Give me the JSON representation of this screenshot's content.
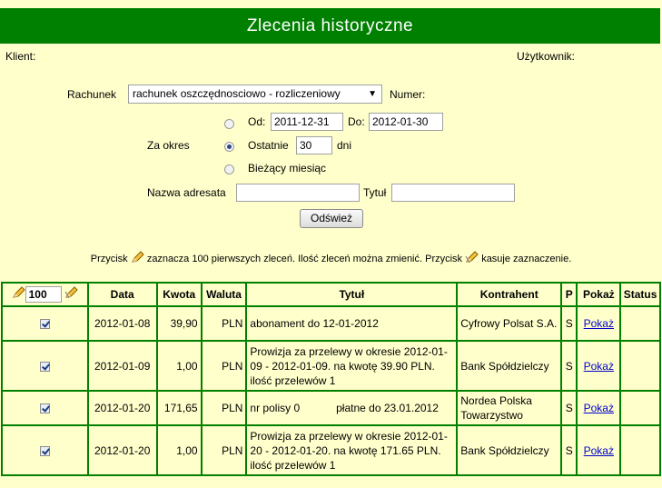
{
  "title": "Zlecenia historyczne",
  "client_label": "Klient:",
  "user_label": "Użytkownik:",
  "account": {
    "label": "Rachunek",
    "selected": "rachunek oszczędnosciowo - rozliczeniowy",
    "number_label": "Numer:"
  },
  "period": {
    "label": "Za okres",
    "from_label": "Od:",
    "from_value": "2011-12-31",
    "to_label": "Do:",
    "to_value": "2012-01-30",
    "last_label": "Ostatnie",
    "last_value": "30",
    "days_label": "dni",
    "current_month_label": "Bieżący miesiąc",
    "selected": "last"
  },
  "payee_label": "Nazwa adresata",
  "payee_value": "",
  "title_label": "Tytuł",
  "title_value": "",
  "refresh_label": "Odśwież",
  "note": {
    "part1": "Przycisk",
    "part2": "zaznacza 100 pierwszych zleceń. Ilość zleceń można zmienić. Przycisk",
    "part3": "kasuje zaznaczenie."
  },
  "table": {
    "select_count": "100",
    "headers": [
      "Data",
      "Kwota",
      "Waluta",
      "Tytuł",
      "Kontrahent",
      "P",
      "Pokaż",
      "Status"
    ],
    "rows": [
      {
        "checked": true,
        "date": "2012-01-08",
        "amount": "39,90",
        "currency": "PLN",
        "title": "abonament do 12-01-2012",
        "counterparty": "Cyfrowy Polsat S.A.",
        "p": "S",
        "show": "Pokaż",
        "status": ""
      },
      {
        "checked": true,
        "date": "2012-01-09",
        "amount": "1,00",
        "currency": "PLN",
        "title": "Prowizja za przelewy w okresie 2012-01-09 - 2012-01-09. na kwotę 39.90 PLN. ilość przelewów 1",
        "counterparty": "Bank Spółdzielczy",
        "p": "S",
        "show": "Pokaż",
        "status": ""
      },
      {
        "checked": true,
        "date": "2012-01-20",
        "amount": "171,65",
        "currency": "PLN",
        "title": "nr polisy 0            płatne do 23.01.2012",
        "counterparty": "Nordea Polska Towarzystwo",
        "p": "S",
        "show": "Pokaż",
        "status": ""
      },
      {
        "checked": true,
        "date": "2012-01-20",
        "amount": "1,00",
        "currency": "PLN",
        "title": "Prowizja za przelewy w okresie 2012-01-20 - 2012-01-20. na kwotę 171.65 PLN. ilość przelewów 1",
        "counterparty": "Bank Spółdzielczy",
        "p": "S",
        "show": "Pokaż",
        "status": ""
      }
    ]
  },
  "colors": {
    "header_bg": "#008000",
    "page_bg": "#ffffcc",
    "border": "#008000",
    "link": "#0000cc"
  },
  "icons": [
    "pencil-select-icon",
    "pencil-clear-icon"
  ]
}
